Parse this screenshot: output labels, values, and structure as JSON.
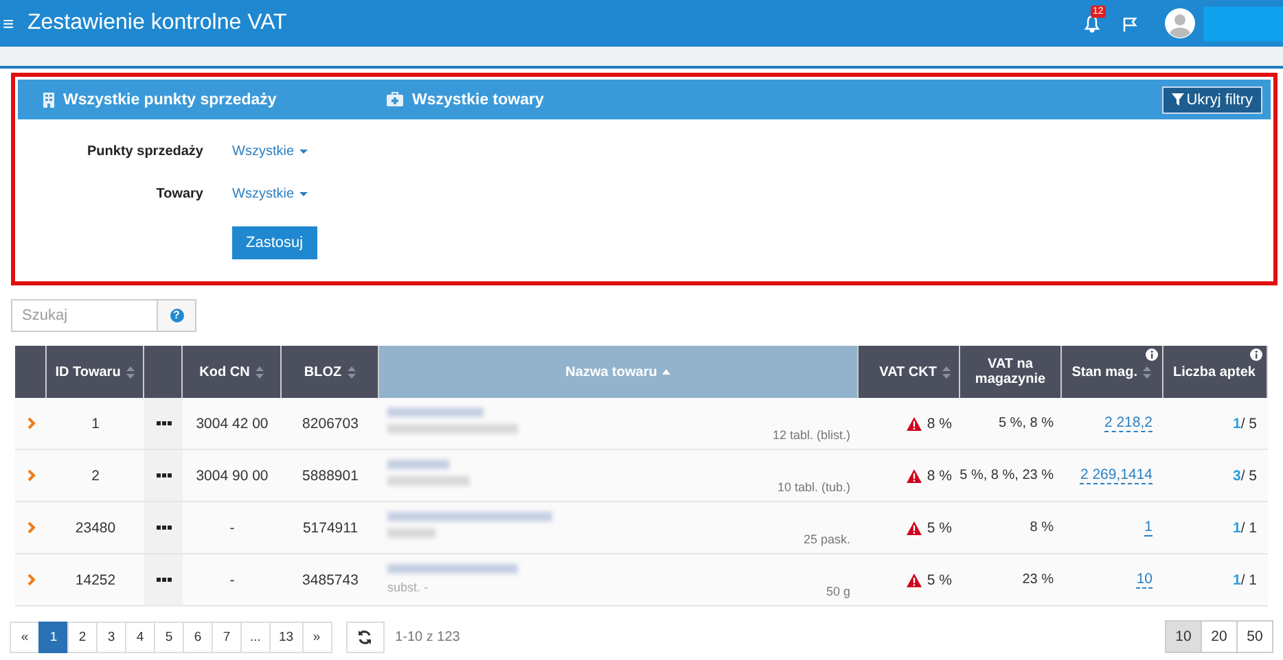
{
  "header": {
    "menu_glyph": "≡",
    "title": "Zestawienie kontrolne VAT",
    "notification_count": "12"
  },
  "filters": {
    "tabs": [
      {
        "label": "Wszystkie punkty sprzedaży"
      },
      {
        "label": "Wszystkie towary"
      }
    ],
    "hide_button": "Ukryj filtry",
    "fields": [
      {
        "label": "Punkty sprzedaży",
        "value": "Wszystkie"
      },
      {
        "label": "Towary",
        "value": "Wszystkie"
      }
    ],
    "apply_button": "Zastosuj"
  },
  "search": {
    "placeholder": "Szukaj",
    "help_glyph": "?"
  },
  "table": {
    "columns": [
      {
        "sortable": false,
        "info": false,
        "selected": false,
        "kind": "toggle"
      },
      {
        "label": "ID Towaru",
        "sortable": true,
        "info": false,
        "selected": false,
        "kind": "id"
      },
      {
        "sortable": false,
        "info": false,
        "selected": false,
        "kind": "menu"
      },
      {
        "label": "Kod CN",
        "sortable": true,
        "info": false,
        "selected": false,
        "kind": "cn"
      },
      {
        "label": "BLOZ",
        "sortable": true,
        "info": false,
        "selected": false,
        "kind": "bloz"
      },
      {
        "label": "Nazwa towaru",
        "sortable": true,
        "info": false,
        "selected": true,
        "kind": "name"
      },
      {
        "label": "VAT CKT",
        "sortable": true,
        "info": false,
        "selected": false,
        "kind": "vat"
      },
      {
        "label": "VAT na magazynie",
        "sortable": false,
        "info": false,
        "selected": false,
        "kind": "vatmag"
      },
      {
        "label": "Stan mag.",
        "sortable": true,
        "info": true,
        "selected": false,
        "kind": "stock"
      },
      {
        "label": "Liczba aptek",
        "sortable": false,
        "info": true,
        "selected": false,
        "kind": "ph"
      }
    ],
    "rows": [
      {
        "id": "1",
        "cn": "3004 42 00",
        "bloz": "8206703",
        "package": "12 tabl. (blist.)",
        "warning": true,
        "vat_ckt": "8 %",
        "vat_mag": "5 %, 8 %",
        "stock": "2 218,2",
        "ph_active": "1",
        "ph_total": "/ 5"
      },
      {
        "id": "2",
        "cn": "3004 90 00",
        "bloz": "5888901",
        "package": "10 tabl. (tub.)",
        "warning": true,
        "vat_ckt": "8 %",
        "vat_mag": "5 %, 8 %, 23 %",
        "stock": "2 269,1414",
        "ph_active": "3",
        "ph_total": "/ 5"
      },
      {
        "id": "23480",
        "cn": "-",
        "bloz": "5174911",
        "package": "25 pask.",
        "warning": true,
        "vat_ckt": "5 %",
        "vat_mag": "8 %",
        "stock": "1",
        "ph_active": "1",
        "ph_total": "/ 1"
      },
      {
        "id": "14252",
        "cn": "-",
        "bloz": "3485743",
        "subtitle": "subst. -",
        "package": "50 g",
        "warning": true,
        "vat_ckt": "5 %",
        "vat_mag": "23 %",
        "stock": "10",
        "ph_active": "1",
        "ph_total": "/ 1"
      }
    ]
  },
  "pagination": {
    "prev": "«",
    "next": "»",
    "pages": [
      {
        "label": "1",
        "selected": true
      },
      {
        "label": "2",
        "selected": false
      },
      {
        "label": "3",
        "selected": false
      },
      {
        "label": "4",
        "selected": false
      },
      {
        "label": "5",
        "selected": false
      },
      {
        "label": "6",
        "selected": false
      },
      {
        "label": "7",
        "selected": false
      },
      {
        "label": "...",
        "selected": false
      },
      {
        "label": "13",
        "selected": false
      }
    ],
    "range": "1-10 z 123",
    "sizes": [
      {
        "label": "10",
        "selected": true
      },
      {
        "label": "20",
        "selected": false
      },
      {
        "label": "50",
        "selected": false
      }
    ]
  }
}
